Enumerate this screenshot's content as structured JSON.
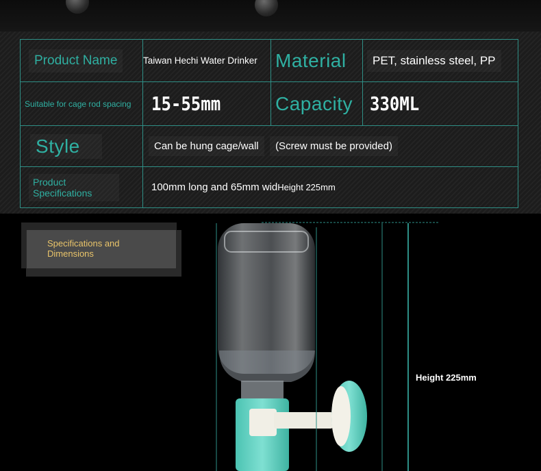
{
  "spec_table": {
    "product_name_label": "Product Name",
    "product_name_value": "Taiwan Hechi Water Drinker",
    "material_label": "Material",
    "material_value": "PET, stainless steel, PP",
    "cage_spacing_label": "Suitable for cage rod spacing",
    "cage_spacing_value": "15-55mm",
    "capacity_label": "Capacity",
    "capacity_value": "330ML",
    "style_label": "Style",
    "style_value_1": "Can be hung cage/wall",
    "style_value_2": "(Screw must be provided)",
    "spec_label": "Product Specifications",
    "spec_value_1": "100mm long and 65mm wid",
    "spec_value_2": "Height 225mm"
  },
  "dimensions": {
    "badge_text": "Specifications and Dimensions",
    "height_label": "Height 225mm"
  },
  "colors": {
    "accent_teal": "#2fb0a2",
    "border_teal": "#2f8f86",
    "badge_text": "#e9c46a",
    "drinker_mint": "#5fd0c0"
  }
}
